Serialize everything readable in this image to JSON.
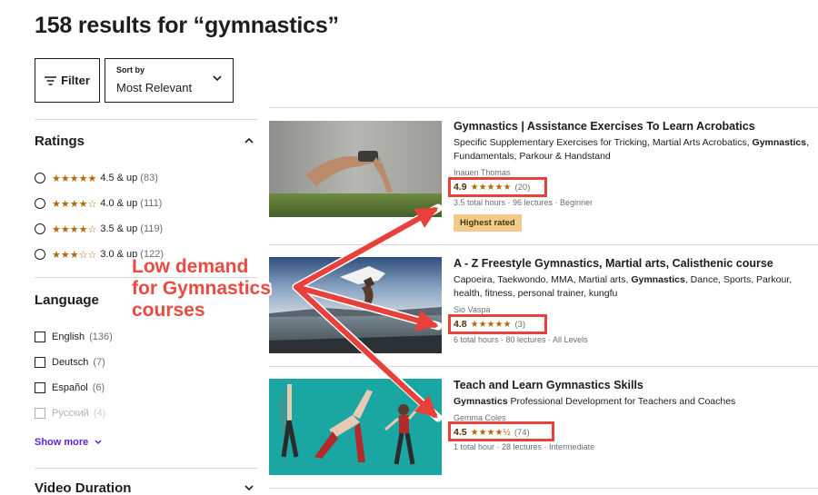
{
  "header": {
    "title": "158 results for “gymnastics”"
  },
  "toolbar": {
    "filter_label": "Filter",
    "sort_label": "Sort by",
    "sort_value": "Most Relevant"
  },
  "sidebar": {
    "ratings_heading": "Ratings",
    "ratings": [
      {
        "stars": "★★★★★",
        "label": "4.5 & up",
        "count": "(83)"
      },
      {
        "stars": "★★★★☆",
        "label": "4.0 & up",
        "count": "(111)"
      },
      {
        "stars": "★★★★☆",
        "label": "3.5 & up",
        "count": "(119)"
      },
      {
        "stars": "★★★☆☆",
        "label": "3.0 & up",
        "count": "(122)"
      }
    ],
    "language_heading": "Language",
    "languages": [
      {
        "label": "English",
        "count": "(136)"
      },
      {
        "label": "Deutsch",
        "count": "(7)"
      },
      {
        "label": "Español",
        "count": "(6)"
      },
      {
        "label": "Русский",
        "count": "(4)"
      }
    ],
    "show_more": "Show more",
    "video_duration_heading": "Video Duration"
  },
  "courses": [
    {
      "title": "Gymnastics | Assistance Exercises To Learn Acrobatics",
      "desc_pre": "Specific Supplementary Exercises for Tricking, Martial Arts Acrobatics, ",
      "desc_bold": "Gymnastics",
      "desc_post": ", Fundamentals, Parkour & Handstand",
      "author": "Inauen Thomas",
      "rating": "4.9",
      "stars": "★★★★★",
      "reviews": "(20)",
      "meta": "3.5 total hours · 96 lectures · Beginner",
      "badge": "Highest rated"
    },
    {
      "title": "A - Z Freestyle Gymnastics, Martial arts, Calisthenic course",
      "desc_pre": "Capoeira, Taekwondo, MMA, Martial arts, ",
      "desc_bold": "Gymnastics",
      "desc_post": ", Dance, Sports, Parkour, health, fitness, personal trainer, kungfu",
      "author": "Sio Vaspa",
      "rating": "4.8",
      "stars": "★★★★★",
      "reviews": "(3)",
      "meta": "6 total hours · 80 lectures · All Levels"
    },
    {
      "title": "Teach and Learn Gymnastics Skills",
      "desc_pre": "",
      "desc_bold": "Gymnastics",
      "desc_post": " Professional Development for Teachers and Coaches",
      "author": "Gemma Coles",
      "rating": "4.5",
      "stars": "★★★★½",
      "reviews": "(74)",
      "meta": "1 total hour · 28 lectures · Intermediate"
    }
  ],
  "annotation": {
    "line1": "Low demand",
    "line2": "for Gymnastics",
    "line3": "courses"
  },
  "colors": {
    "accent": "#5624d0",
    "star": "#b4690e",
    "annotation": "#e8403a",
    "badge": "#f3ca8c"
  }
}
